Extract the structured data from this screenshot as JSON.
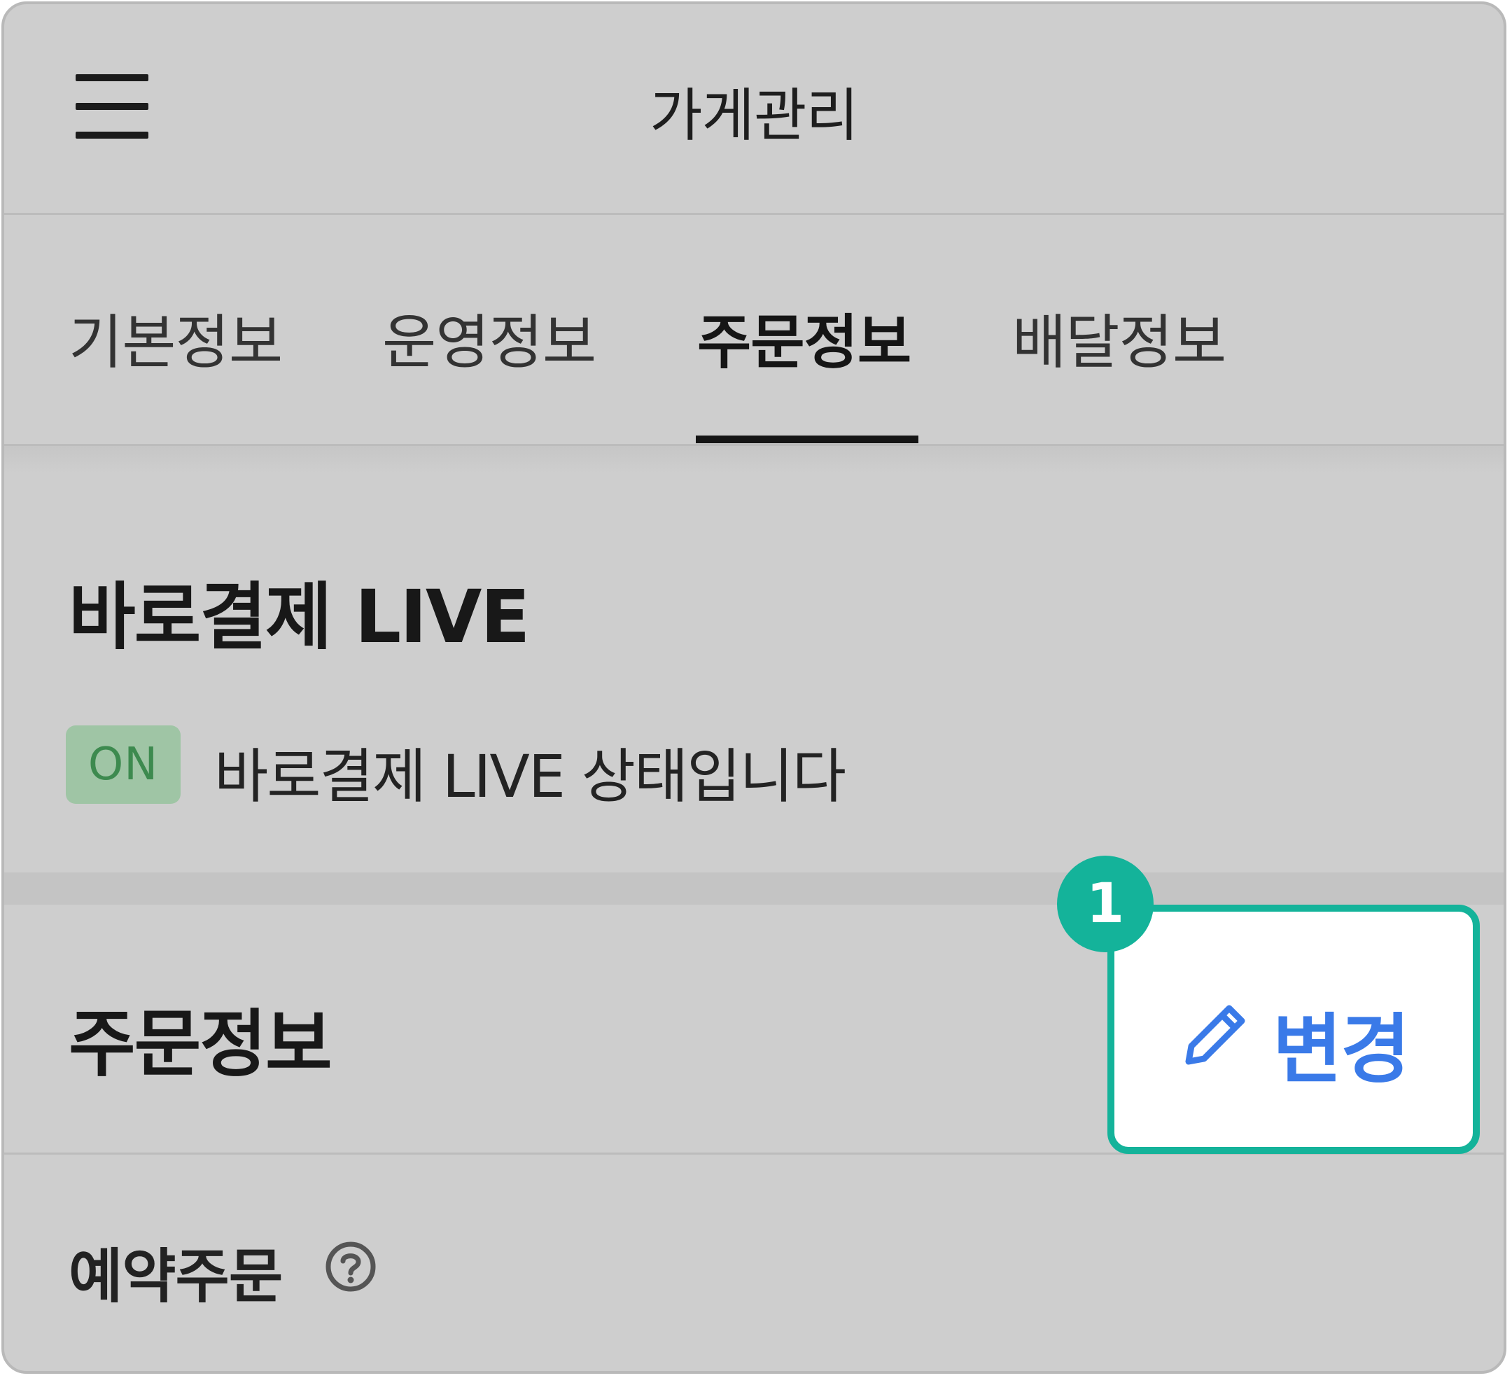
{
  "header": {
    "menu_icon": "hamburger-menu-icon",
    "title": "가게관리"
  },
  "tabs": [
    {
      "label": "기본정보",
      "active": false
    },
    {
      "label": "운영정보",
      "active": false
    },
    {
      "label": "주문정보",
      "active": true
    },
    {
      "label": "배달정보",
      "active": false
    }
  ],
  "live_section": {
    "title": "바로결제 LIVE",
    "badge": "ON",
    "status_text": "바로결제 LIVE 상태입니다"
  },
  "order_section": {
    "title": "주문정보",
    "change_button": {
      "icon": "pencil-icon",
      "label": "변경"
    },
    "reserve_label": "예약주문",
    "help_icon": "question-circle-icon"
  },
  "annotation": {
    "step_number": "1"
  },
  "colors": {
    "highlight": "#14b39a",
    "change_text": "#3a7ae8",
    "on_badge_bg": "#9fc5a5",
    "on_badge_text": "#3d8a4f"
  }
}
